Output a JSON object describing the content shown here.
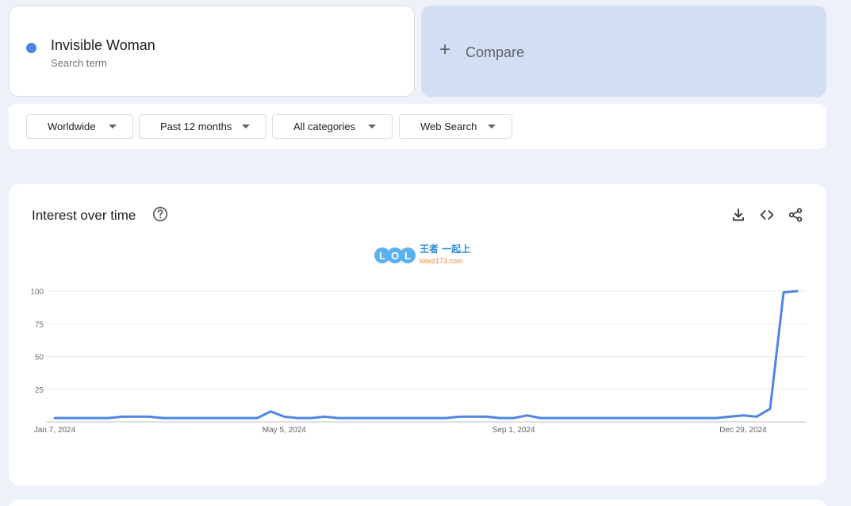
{
  "search_term": {
    "name": "Invisible Woman",
    "subtitle": "Search term",
    "color": "#4e86e2"
  },
  "compare": {
    "label": "Compare"
  },
  "filters": [
    {
      "label": "Worldwide"
    },
    {
      "label": "Past 12 months"
    },
    {
      "label": "All categories"
    },
    {
      "label": "Web Search"
    }
  ],
  "chart_panel": {
    "title": "Interest over time",
    "help_icon": "help-circle-icon",
    "tools": [
      "download-icon",
      "embed-code-icon",
      "share-icon"
    ]
  },
  "watermark": {
    "logo": "LOL",
    "brand": "王者 一起上",
    "site": "lolwz173.com"
  },
  "chart_data": {
    "type": "line",
    "x_tick_labels": [
      "Jan 7, 2024",
      "May 5, 2024",
      "Sep 1, 2024",
      "Dec 29, 2024"
    ],
    "y_ticks": [
      25,
      50,
      75,
      100
    ],
    "ylim": [
      0,
      100
    ],
    "grid": true,
    "series": [
      {
        "color": "#4e86e2",
        "values": [
          3,
          3,
          3,
          3,
          3,
          4,
          4,
          4,
          3,
          3,
          3,
          3,
          3,
          3,
          3,
          3,
          8,
          4,
          3,
          3,
          4,
          3,
          3,
          3,
          3,
          3,
          3,
          3,
          3,
          3,
          4,
          4,
          4,
          3,
          3,
          5,
          3,
          3,
          3,
          3,
          3,
          3,
          3,
          3,
          3,
          3,
          3,
          3,
          3,
          3,
          4,
          5,
          4,
          10,
          99,
          100
        ]
      }
    ]
  }
}
